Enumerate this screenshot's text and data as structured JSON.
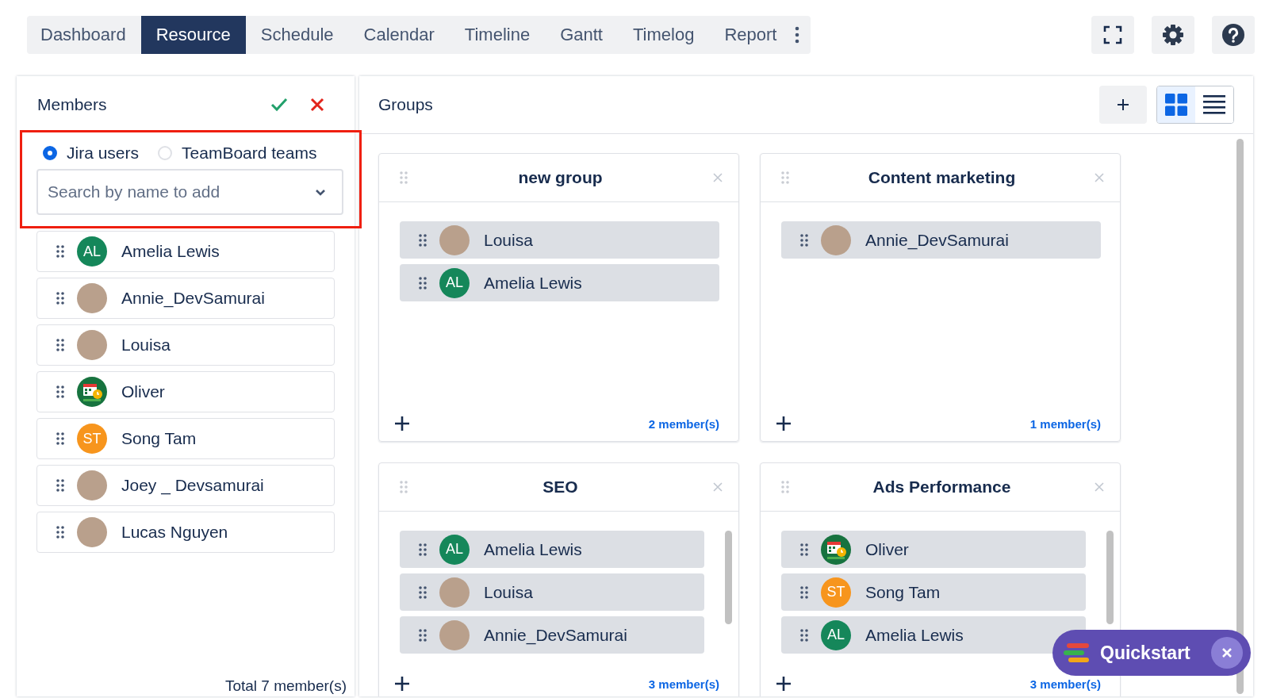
{
  "tabs": [
    {
      "label": "Dashboard",
      "selected": false
    },
    {
      "label": "Resource",
      "selected": true
    },
    {
      "label": "Schedule",
      "selected": false
    },
    {
      "label": "Calendar",
      "selected": false
    },
    {
      "label": "Timeline",
      "selected": false
    },
    {
      "label": "Gantt",
      "selected": false
    },
    {
      "label": "Timelog",
      "selected": false
    },
    {
      "label": "Report",
      "selected": false
    }
  ],
  "members_panel": {
    "title": "Members",
    "source_options": [
      {
        "label": "Jira users",
        "selected": true
      },
      {
        "label": "TeamBoard teams",
        "selected": false
      }
    ],
    "search": {
      "placeholder": "Search by name to add"
    },
    "members": [
      {
        "name": "Amelia Lewis",
        "avatar": {
          "kind": "initials",
          "initials": "AL",
          "color": "#15875a"
        }
      },
      {
        "name": "Annie_DevSamurai",
        "avatar": {
          "kind": "photo"
        }
      },
      {
        "name": "Louisa",
        "avatar": {
          "kind": "photo"
        }
      },
      {
        "name": "Oliver",
        "avatar": {
          "kind": "logo"
        }
      },
      {
        "name": "Song Tam",
        "avatar": {
          "kind": "initials",
          "initials": "ST",
          "color": "#f7951d"
        }
      },
      {
        "name": "Joey _ Devsamurai",
        "avatar": {
          "kind": "photo"
        }
      },
      {
        "name": "Lucas Nguyen",
        "avatar": {
          "kind": "photo"
        }
      }
    ],
    "total": "Total 7 member(s)"
  },
  "groups_panel": {
    "title": "Groups",
    "views": [
      {
        "kind": "grid",
        "selected": true
      },
      {
        "kind": "list",
        "selected": false
      }
    ],
    "groups": [
      {
        "title": "new group",
        "count": "2 member(s)",
        "members": [
          {
            "name": "Louisa",
            "avatar": {
              "kind": "photo"
            }
          },
          {
            "name": "Amelia Lewis",
            "avatar": {
              "kind": "initials",
              "initials": "AL",
              "color": "#15875a"
            }
          }
        ]
      },
      {
        "title": "Content marketing",
        "count": "1 member(s)",
        "members": [
          {
            "name": "Annie_DevSamurai",
            "avatar": {
              "kind": "photo"
            }
          }
        ]
      },
      {
        "title": "SEO",
        "count": "3 member(s)",
        "members": [
          {
            "name": "Amelia Lewis",
            "avatar": {
              "kind": "initials",
              "initials": "AL",
              "color": "#15875a"
            }
          },
          {
            "name": "Louisa",
            "avatar": {
              "kind": "photo"
            }
          },
          {
            "name": "Annie_DevSamurai",
            "avatar": {
              "kind": "photo"
            }
          }
        ]
      },
      {
        "title": "Ads Performance",
        "count": "3 member(s)",
        "members": [
          {
            "name": "Oliver",
            "avatar": {
              "kind": "logo"
            }
          },
          {
            "name": "Song Tam",
            "avatar": {
              "kind": "initials",
              "initials": "ST",
              "color": "#f7951d"
            }
          },
          {
            "name": "Amelia Lewis",
            "avatar": {
              "kind": "initials",
              "initials": "AL",
              "color": "#15875a"
            }
          }
        ]
      }
    ]
  },
  "quickstart": {
    "label": "Quickstart"
  }
}
